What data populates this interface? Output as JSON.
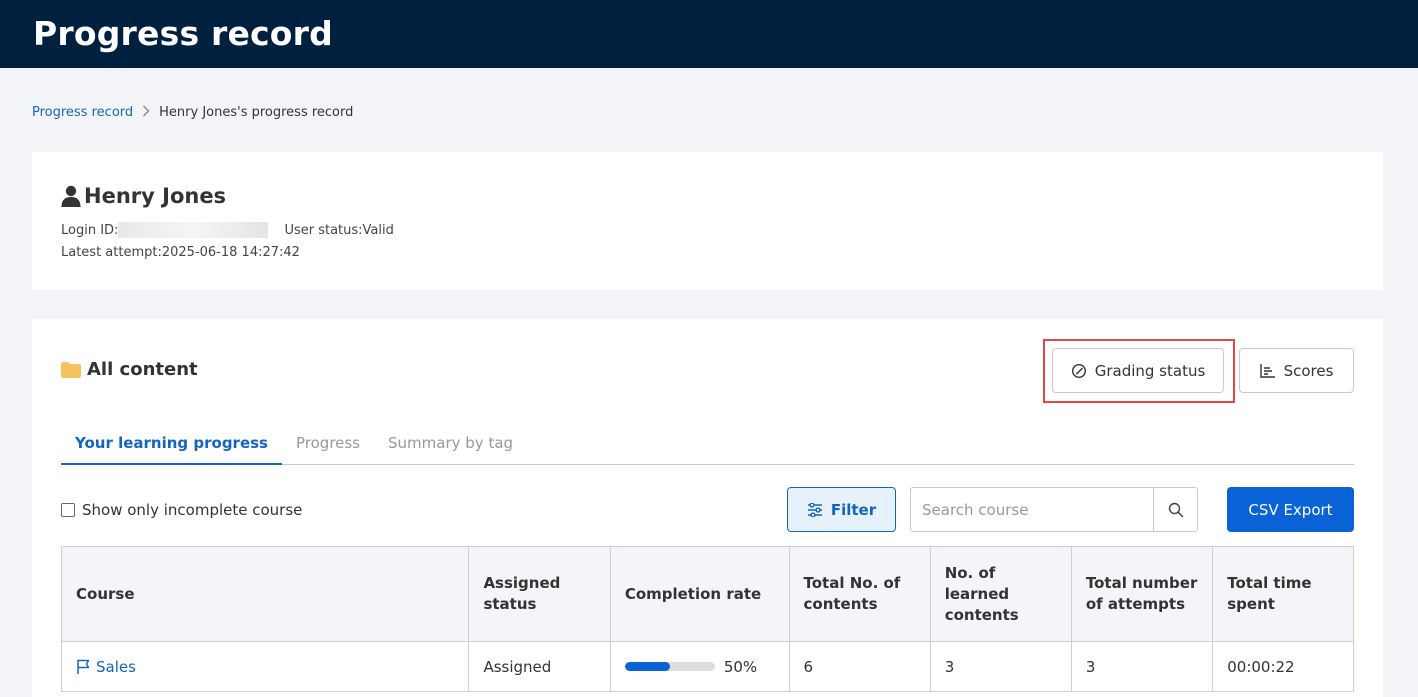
{
  "header": {
    "title": "Progress record"
  },
  "breadcrumb": {
    "root": "Progress record",
    "current": "Henry Jones's progress record"
  },
  "user": {
    "name": "Henry Jones",
    "login_id_label": "Login ID:",
    "status_label": "User status:",
    "status_value": "Valid",
    "latest_attempt_label": "Latest attempt:",
    "latest_attempt_value": "2025-06-18 14:27:42"
  },
  "content": {
    "title": "All content",
    "grading_button": "Grading status",
    "scores_button": "Scores",
    "tabs": [
      {
        "label": "Your learning progress",
        "active": true
      },
      {
        "label": "Progress",
        "active": false
      },
      {
        "label": "Summary by tag",
        "active": false
      }
    ],
    "incomplete_checkbox_label": "Show only incomplete course",
    "incomplete_checked": false,
    "filter_button": "Filter",
    "search_placeholder": "Search course",
    "csv_button": "CSV Export"
  },
  "table": {
    "headers": [
      "Course",
      "Assigned status",
      "Completion rate",
      "Total No. of contents",
      "No. of learned contents",
      "Total number of attempts",
      "Total time spent"
    ],
    "rows": [
      {
        "course": "Sales",
        "assigned": "Assigned",
        "completion_rate": 0.5,
        "completion_label": "50%",
        "total_contents": "6",
        "learned_contents": "3",
        "attempts": "3",
        "time_spent": "00:00:22"
      }
    ]
  },
  "colors": {
    "header_bg": "#002040",
    "accent": "#0a63d6",
    "highlight": "#e04848"
  }
}
